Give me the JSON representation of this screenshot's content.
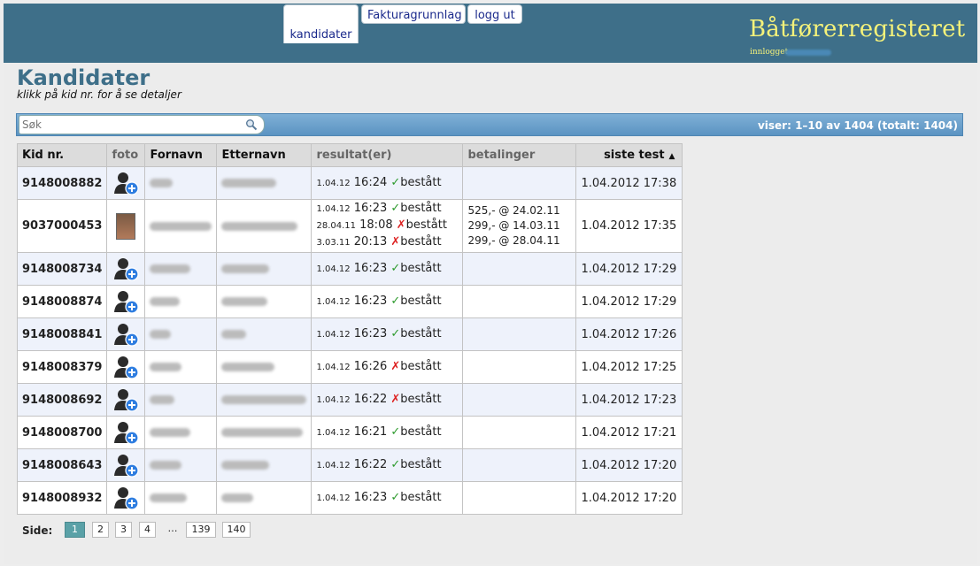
{
  "nav": {
    "tabs": [
      "kandidater",
      "Fakturagrunnlag",
      "logg ut"
    ]
  },
  "logo": {
    "title": "Båtførerregisteret",
    "sub": "innlogget"
  },
  "page": {
    "title": "Kandidater",
    "subtitle": "klikk på kid nr. for å se detaljer"
  },
  "search": {
    "placeholder": "Søk",
    "status": "viser: 1–10 av 1404 (totalt: 1404)"
  },
  "table": {
    "headers": [
      "Kid nr.",
      "foto",
      "Fornavn",
      "Etternavn",
      "resultat(er)",
      "betalinger",
      "siste test"
    ],
    "rows": [
      {
        "kid": "9148008882",
        "fn_w": 26,
        "en_w": 62,
        "results": [
          {
            "d": "1.04.12",
            "t": "16:24",
            "ok": true,
            "label": "bestått"
          }
        ],
        "payments": [],
        "last": "1.04.2012 17:38"
      },
      {
        "kid": "9037000453",
        "fn_w": 70,
        "en_w": 86,
        "photo": true,
        "results": [
          {
            "d": "1.04.12",
            "t": "16:23",
            "ok": true,
            "label": "bestått"
          },
          {
            "d": "28.04.11",
            "t": "18:08",
            "ok": false,
            "label": "bestått"
          },
          {
            "d": "3.03.11",
            "t": "20:13",
            "ok": false,
            "label": "bestått"
          }
        ],
        "payments": [
          "525,- @ 24.02.11",
          "299,- @ 14.03.11",
          "299,- @ 28.04.11"
        ],
        "last": "1.04.2012 17:35"
      },
      {
        "kid": "9148008734",
        "fn_w": 46,
        "en_w": 54,
        "results": [
          {
            "d": "1.04.12",
            "t": "16:23",
            "ok": true,
            "label": "bestått"
          }
        ],
        "payments": [],
        "last": "1.04.2012 17:29"
      },
      {
        "kid": "9148008874",
        "fn_w": 34,
        "en_w": 52,
        "results": [
          {
            "d": "1.04.12",
            "t": "16:23",
            "ok": true,
            "label": "bestått"
          }
        ],
        "payments": [],
        "last": "1.04.2012 17:29"
      },
      {
        "kid": "9148008841",
        "fn_w": 24,
        "en_w": 28,
        "results": [
          {
            "d": "1.04.12",
            "t": "16:23",
            "ok": true,
            "label": "bestått"
          }
        ],
        "payments": [],
        "last": "1.04.2012 17:26"
      },
      {
        "kid": "9148008379",
        "fn_w": 36,
        "en_w": 60,
        "results": [
          {
            "d": "1.04.12",
            "t": "16:26",
            "ok": false,
            "label": "bestått"
          }
        ],
        "payments": [],
        "last": "1.04.2012 17:25"
      },
      {
        "kid": "9148008692",
        "fn_w": 28,
        "en_w": 96,
        "results": [
          {
            "d": "1.04.12",
            "t": "16:22",
            "ok": false,
            "label": "bestått"
          }
        ],
        "payments": [],
        "last": "1.04.2012 17:23"
      },
      {
        "kid": "9148008700",
        "fn_w": 46,
        "en_w": 92,
        "results": [
          {
            "d": "1.04.12",
            "t": "16:21",
            "ok": true,
            "label": "bestått"
          }
        ],
        "payments": [],
        "last": "1.04.2012 17:21"
      },
      {
        "kid": "9148008643",
        "fn_w": 36,
        "en_w": 54,
        "results": [
          {
            "d": "1.04.12",
            "t": "16:22",
            "ok": true,
            "label": "bestått"
          }
        ],
        "payments": [],
        "last": "1.04.2012 17:20"
      },
      {
        "kid": "9148008932",
        "fn_w": 42,
        "en_w": 36,
        "results": [
          {
            "d": "1.04.12",
            "t": "16:23",
            "ok": true,
            "label": "bestått"
          }
        ],
        "payments": [],
        "last": "1.04.2012 17:20"
      }
    ]
  },
  "pager": {
    "label": "Side:",
    "pages": [
      "1",
      "2",
      "3",
      "4",
      "…",
      "139",
      "140"
    ],
    "current": "1"
  },
  "colors": {
    "topbar": "#3e6f89",
    "logo": "#f5f27a",
    "pass": "#2c9a2c",
    "fail": "#d22222"
  }
}
